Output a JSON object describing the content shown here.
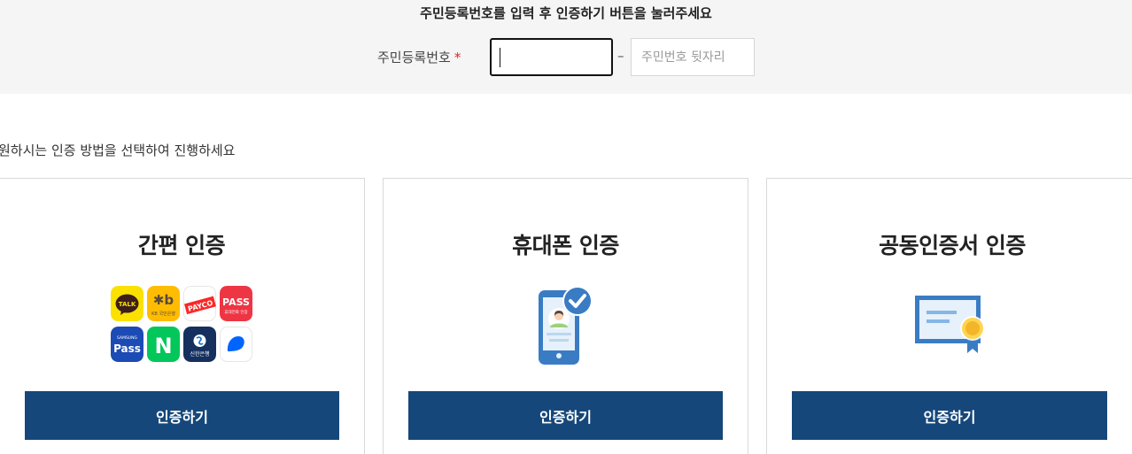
{
  "header": {
    "instruction": "주민등록번호를 입력 후 인증하기 버튼을 눌러주세요",
    "rrn_label": "주민등록번호",
    "required_mark": "*",
    "rrn_front_value": "",
    "dash": "–",
    "rrn_back_placeholder": "주민번호 뒷자리"
  },
  "choose_text": "원하시는 인증 방법을 선택하여 진행하세요",
  "cards": [
    {
      "title": "간편 인증",
      "button": "인증하기"
    },
    {
      "title": "휴대폰 인증",
      "button": "인증하기"
    },
    {
      "title": "공동인증서 인증",
      "button": "인증하기"
    }
  ],
  "apps": {
    "kakao": "TALK",
    "kb": "KB 국민은행",
    "payco": "PAYCO",
    "pass": "PASS",
    "pass_sub": "휴대전화 인증",
    "samsung": "SAMSUNG",
    "samsung_pass": "Pass",
    "naver": "N",
    "shinhan": "신한은행"
  },
  "colors": {
    "button_bg": "#15477a",
    "button_text": "#ffffff",
    "required": "#e0261c",
    "top_band": "#f5f5f5"
  }
}
